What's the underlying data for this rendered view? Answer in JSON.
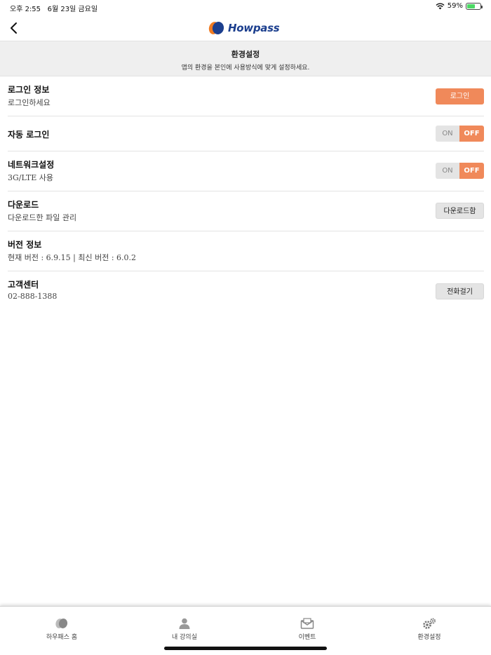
{
  "status_bar": {
    "time": "오후 2:55",
    "date": "6월 23일 금요일",
    "battery": "59%",
    "battery_level": 0.59
  },
  "header": {
    "brand": "Howpass"
  },
  "banner": {
    "title": "환경설정",
    "subtitle": "앱의 환경을 본인에 사용방식에 맞게 설정하세요."
  },
  "settings": {
    "login": {
      "label": "로그인 정보",
      "desc": "로그인하세요",
      "button": "로그인"
    },
    "auto_login": {
      "label": "자동 로그인",
      "on": "ON",
      "off": "OFF",
      "state": "OFF"
    },
    "network": {
      "label": "네트워크설정",
      "desc": "3G/LTE 사용",
      "on": "ON",
      "off": "OFF",
      "state": "OFF"
    },
    "download": {
      "label": "다운로드",
      "desc": "다운로드한 파일 관리",
      "button": "다운로드함"
    },
    "version": {
      "label": "버전 정보",
      "desc": "현재 버전 : 6.9.15 | 최신 버전 : 6.0.2"
    },
    "support": {
      "label": "고객센터",
      "desc": "02-888-1388",
      "button": "전화걸기"
    }
  },
  "tabs": [
    {
      "label": "하우패스 홈",
      "icon": "howpass-home-icon"
    },
    {
      "label": "내 강의실",
      "icon": "person-icon"
    },
    {
      "label": "이벤트",
      "icon": "envelope-icon"
    },
    {
      "label": "환경설정",
      "icon": "gears-icon"
    }
  ],
  "colors": {
    "accent": "#f0895a",
    "brand_blue": "#1c3f8e",
    "brand_orange": "#f07b22",
    "banner_bg": "#efefef"
  }
}
